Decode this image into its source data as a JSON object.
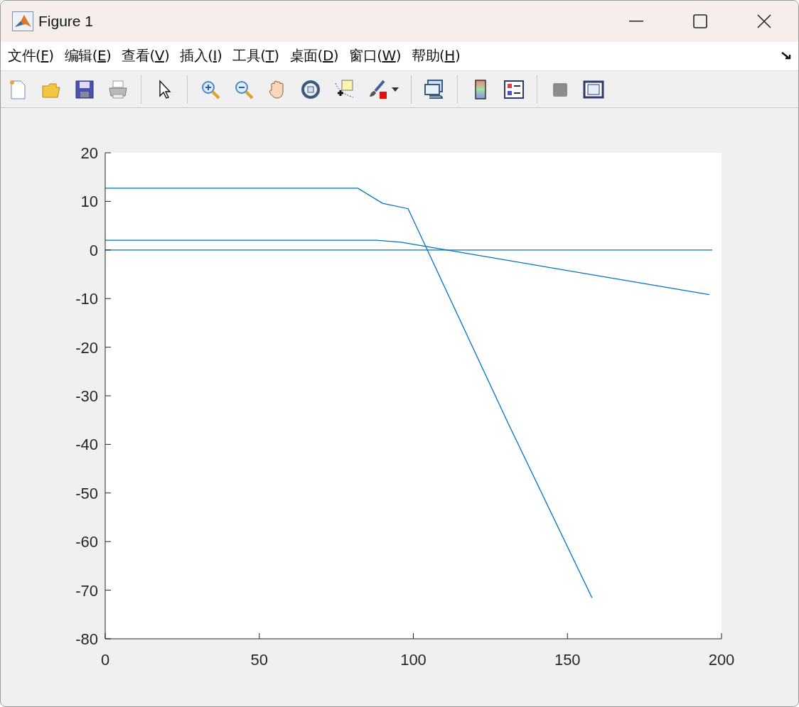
{
  "window": {
    "title": "Figure 1"
  },
  "menu": [
    "文件(F)",
    "编辑(E)",
    "查看(V)",
    "插入(I)",
    "工具(T)",
    "桌面(D)",
    "窗口(W)",
    "帮助(H)"
  ],
  "axes": {
    "chart_data": {
      "type": "line",
      "xlim": [
        0,
        200
      ],
      "ylim": [
        -80,
        20
      ],
      "xticks": [
        0,
        50,
        100,
        150,
        200
      ],
      "yticks": [
        -80,
        -70,
        -60,
        -50,
        -40,
        -30,
        -20,
        -10,
        0,
        10,
        20
      ],
      "series": [
        {
          "color": "#0072bd",
          "x": [
            0,
            82,
            90,
            98.3,
            131,
            158
          ],
          "values": [
            12.7,
            12.7,
            9.6,
            8.5,
            -36,
            -71.6
          ]
        },
        {
          "color": "#0072bd",
          "x": [
            0,
            88,
            96,
            196
          ],
          "values": [
            2,
            2,
            1.6,
            -9.2
          ]
        },
        {
          "color": "#0072bd",
          "x": [
            0,
            197
          ],
          "values": [
            0,
            0
          ]
        }
      ]
    }
  }
}
